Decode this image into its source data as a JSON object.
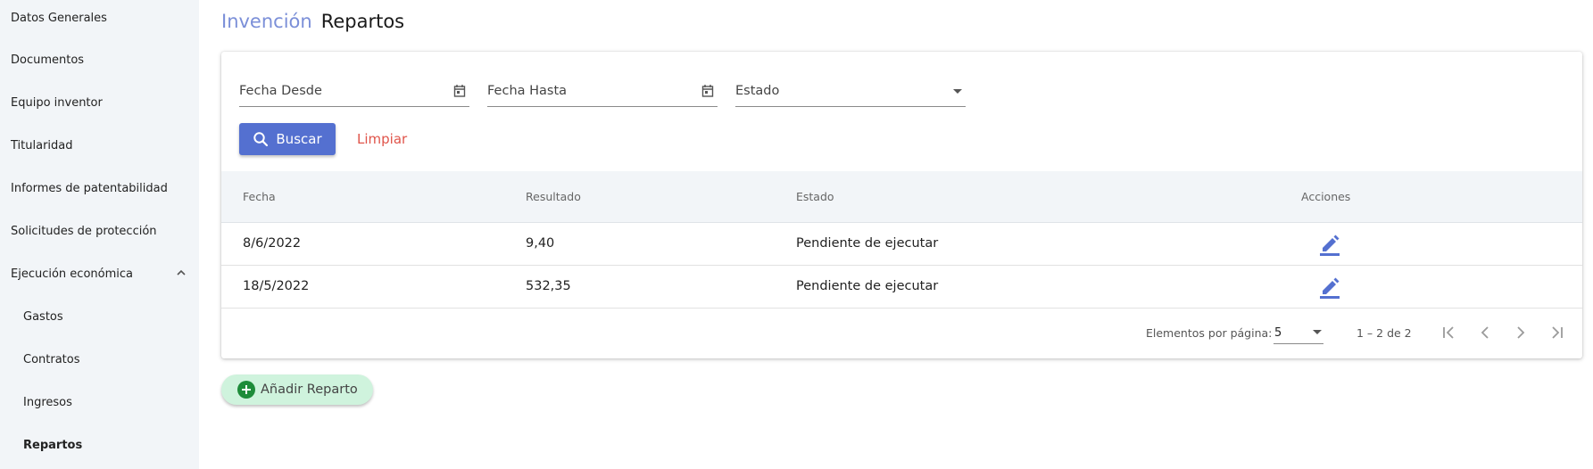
{
  "sidebar": {
    "items": [
      {
        "label": "Datos Generales"
      },
      {
        "label": "Documentos"
      },
      {
        "label": "Equipo inventor"
      },
      {
        "label": "Titularidad"
      },
      {
        "label": "Informes de patentabilidad"
      },
      {
        "label": "Solicitudes de protección"
      },
      {
        "label": "Ejecución económica"
      }
    ],
    "subitems": [
      {
        "label": "Gastos"
      },
      {
        "label": "Contratos"
      },
      {
        "label": "Ingresos"
      },
      {
        "label": "Repartos"
      }
    ]
  },
  "header": {
    "parent": "Invención",
    "current": "Repartos"
  },
  "filters": {
    "fecha_desde": "Fecha Desde",
    "fecha_hasta": "Fecha Hasta",
    "estado": "Estado",
    "buscar_label": "Buscar",
    "limpiar_label": "Limpiar"
  },
  "table": {
    "columns": [
      "Fecha",
      "Resultado",
      "Estado",
      "Acciones"
    ],
    "rows": [
      {
        "fecha": "8/6/2022",
        "resultado": "9,40",
        "estado": "Pendiente de ejecutar"
      },
      {
        "fecha": "18/5/2022",
        "resultado": "532,35",
        "estado": "Pendiente de ejecutar"
      }
    ]
  },
  "paginator": {
    "label": "Elementos por página:",
    "page_size": "5",
    "range": "1 – 2 de 2"
  },
  "add_button": {
    "label": "Añadir Reparto"
  },
  "colors": {
    "primary": "#5470d0",
    "link": "#7b8fd8",
    "warn": "#e0544a",
    "add_bg": "#cff3dd",
    "add_icon": "#1e8c3a",
    "sidebar_bg": "#f2f5f8"
  },
  "icons": {
    "date": "calendar-icon",
    "search": "search-icon",
    "edit": "pencil-icon",
    "add": "plus-circle-icon",
    "collapse": "chevron-up-icon"
  }
}
